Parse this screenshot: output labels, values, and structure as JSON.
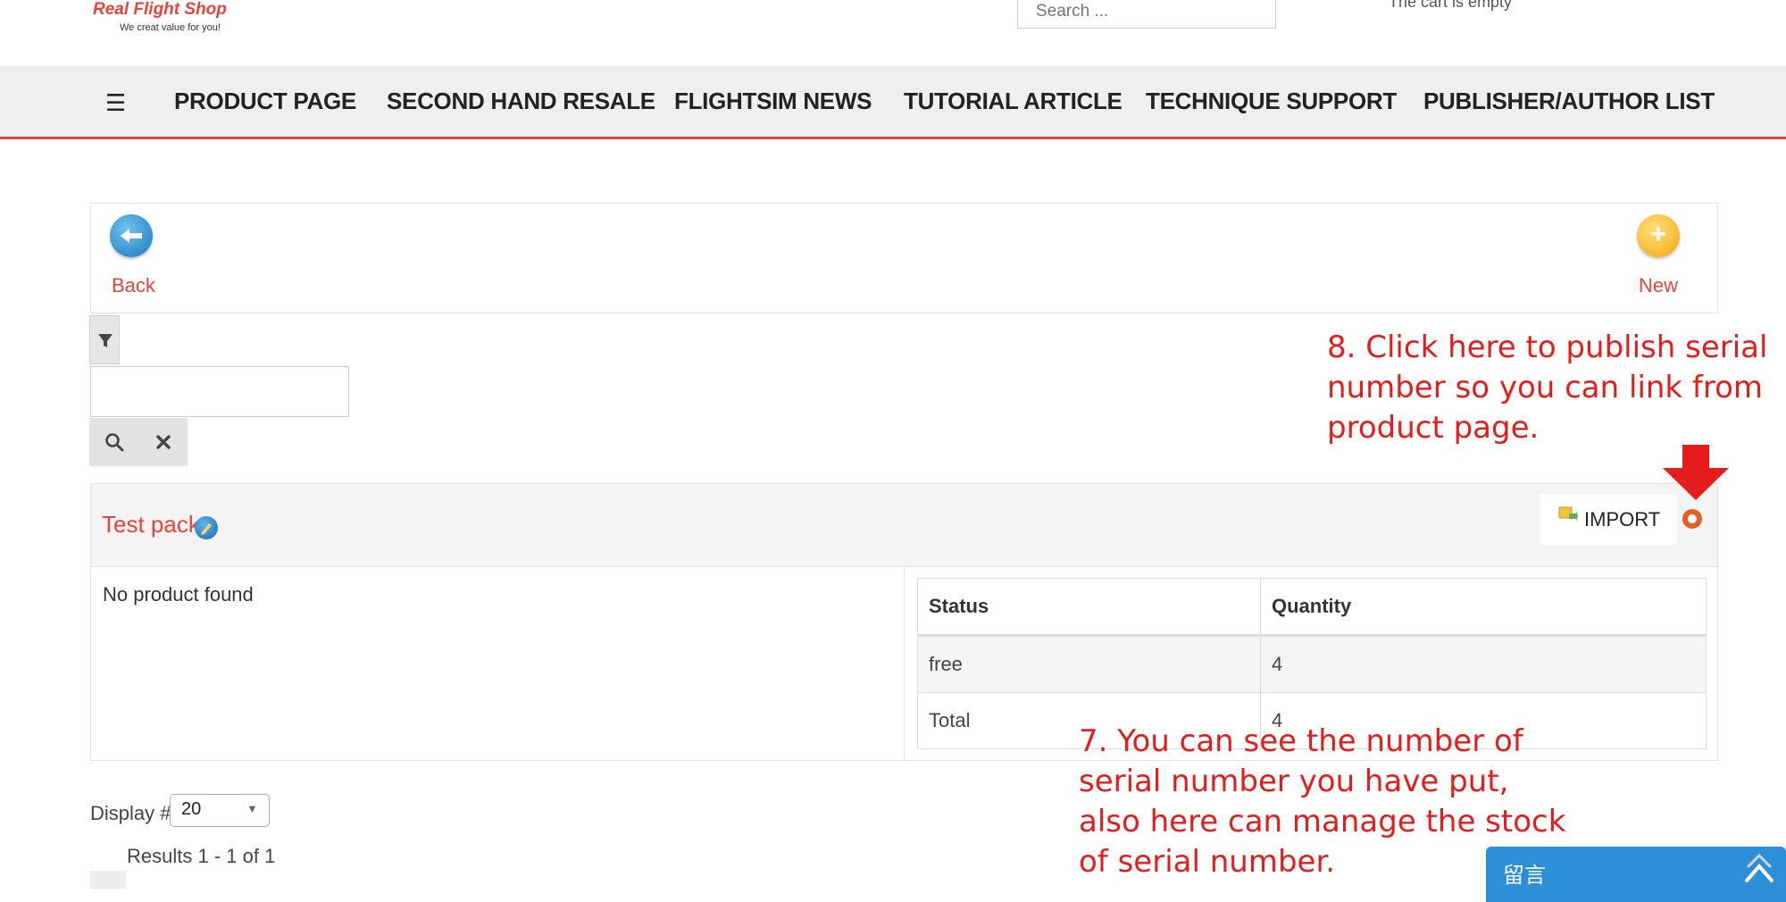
{
  "header": {
    "logo_title": "Real Flight Shop",
    "logo_tagline": "We creat value for you!",
    "search_placeholder": "Search ...",
    "cart_status": "The cart is empty"
  },
  "nav": {
    "menu_icon": "hamburger-icon",
    "items": [
      {
        "label": "PRODUCT PAGE"
      },
      {
        "label": "SECOND HAND RESALE"
      },
      {
        "label": "FLIGHTSIM NEWS"
      },
      {
        "label": "TUTORIAL ARTICLE"
      },
      {
        "label": "TECHNIQUE SUPPORT"
      },
      {
        "label": "PUBLISHER/AUTHOR LIST"
      }
    ],
    "accent_color": "#e8433a"
  },
  "toolbar": {
    "back_label": "Back",
    "new_label": "New"
  },
  "filters": {
    "toggle_icon": "filter-icon",
    "search_icon": "search-icon",
    "clear_icon": "close-icon",
    "value": ""
  },
  "pack": {
    "title": "Test pack",
    "import_label": "IMPORT",
    "no_product": "No product found",
    "stock": {
      "columns": [
        "Status",
        "Quantity"
      ],
      "rows": [
        {
          "status": "free",
          "quantity": "4"
        },
        {
          "status": "Total",
          "quantity": "4"
        }
      ]
    }
  },
  "pagination": {
    "display_label": "Display #",
    "display_value": "20",
    "results": "Results 1 - 1 of 1"
  },
  "annotations": {
    "step8": [
      "8. Click here to publish serial",
      "number so you can link from",
      "product page."
    ],
    "step7": [
      "7. You can see the number of",
      "serial number you have put,",
      "also here can manage the stock",
      "of serial number."
    ],
    "color": "#e51c1c"
  },
  "chat": {
    "label": "留言"
  }
}
